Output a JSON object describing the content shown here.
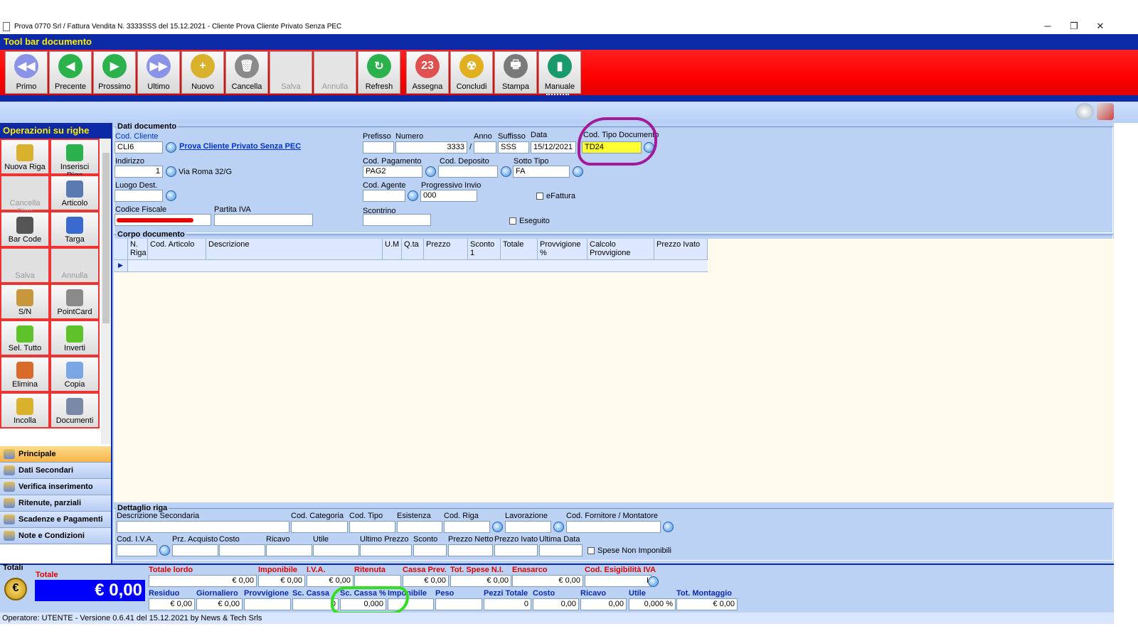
{
  "window": {
    "title": "Prova 0770 Srl / Fattura Vendita N. 3333SSS del 15.12.2021 - Cliente Prova Cliente Privato Senza PEC",
    "minimize": "─",
    "restore": "❐",
    "close": "✕"
  },
  "toolbar": {
    "title": "Tool bar documento",
    "buttons": [
      {
        "label": "Primo",
        "icon": "first-icon",
        "glyph": "◀◀",
        "color": "#8a93e6",
        "enabled": true
      },
      {
        "label": "Precente",
        "icon": "previous-icon",
        "glyph": "◀",
        "color": "#2bb24c",
        "enabled": true
      },
      {
        "label": "Prossimo",
        "icon": "next-icon",
        "glyph": "▶",
        "color": "#2bb24c",
        "enabled": true
      },
      {
        "label": "Ultimo",
        "icon": "last-icon",
        "glyph": "▶▶",
        "color": "#8a93e6",
        "enabled": true
      },
      {
        "label": "Nuovo",
        "icon": "new-icon",
        "glyph": "+",
        "color": "#d9b12c",
        "enabled": true
      },
      {
        "label": "Cancella",
        "icon": "trash-icon",
        "glyph": "🗑",
        "color": "#8a8a8a",
        "enabled": true
      },
      {
        "label": "Salva",
        "icon": "save-icon",
        "glyph": "",
        "color": "#e4e4e4",
        "enabled": false
      },
      {
        "label": "Annulla",
        "icon": "undo-icon",
        "glyph": "",
        "color": "#e4e4e4",
        "enabled": false
      },
      {
        "label": "Refresh",
        "icon": "refresh-icon",
        "glyph": "↻",
        "color": "#2bb24c",
        "enabled": true
      },
      {
        "label": "Assegna",
        "icon": "calendar-numbers-icon",
        "glyph": "23",
        "color": "#e05050",
        "enabled": true
      },
      {
        "label": "Concludi",
        "icon": "radiation-icon",
        "glyph": "☢",
        "color": "#e0b020",
        "enabled": true
      },
      {
        "label": "Stampa",
        "icon": "printer-icon",
        "glyph": "🖶",
        "color": "#7a7a7a",
        "enabled": true
      },
      {
        "label": "Manuale",
        "icon": "book-icon",
        "glyph": "▮",
        "color": "#1a9a6a",
        "enabled": true
      }
    ]
  },
  "side": {
    "title": "Operazioni su righe",
    "buttons": [
      {
        "label": "Nuova Riga",
        "icon": "new-row-icon",
        "color": "#d9b12c",
        "enabled": true
      },
      {
        "label": "Inserisci Riga",
        "icon": "insert-row-icon",
        "color": "#2bb24c",
        "enabled": true
      },
      {
        "label": "Cancella Riga",
        "icon": "delete-row-icon",
        "color": "#e0e0e0",
        "enabled": false
      },
      {
        "label": "Articolo",
        "icon": "article-icon",
        "color": "#5a7ab0",
        "enabled": true
      },
      {
        "label": "Bar Code",
        "icon": "barcode-icon",
        "color": "#555555",
        "enabled": true
      },
      {
        "label": "Targa",
        "icon": "license-plate-icon",
        "color": "#3a6ad0",
        "enabled": true
      },
      {
        "label": "Salva",
        "icon": "save-row-icon",
        "color": "#e0e0e0",
        "enabled": false
      },
      {
        "label": "Annulla",
        "icon": "undo-row-icon",
        "color": "#e0e0e0",
        "enabled": false
      },
      {
        "label": "S/N",
        "icon": "serial-number-icon",
        "color": "#c8963c",
        "enabled": true
      },
      {
        "label": "PointCard",
        "icon": "point-card-icon",
        "color": "#8a8a8a",
        "enabled": true
      },
      {
        "label": "Sel. Tutto",
        "icon": "select-all-arrow-icon",
        "color": "#5ec22a",
        "enabled": true
      },
      {
        "label": "Inverti",
        "icon": "invert-arrow-icon",
        "color": "#5ec22a",
        "enabled": true
      },
      {
        "label": "Elimina",
        "icon": "delete-icon",
        "color": "#d86a2a",
        "enabled": true
      },
      {
        "label": "Copia",
        "icon": "copy-icon",
        "color": "#7aa6e6",
        "enabled": true
      },
      {
        "label": "Incolla",
        "icon": "paste-icon",
        "color": "#d9b12c",
        "enabled": true
      },
      {
        "label": "Documenti",
        "icon": "documents-icon",
        "color": "#7a8aa6",
        "enabled": true
      }
    ],
    "nav": [
      {
        "label": "Principale",
        "icon": "main-tab-icon",
        "active": true
      },
      {
        "label": "Dati Secondari",
        "icon": "secondary-data-icon",
        "active": false
      },
      {
        "label": "Verifica inserimento",
        "icon": "verify-icon",
        "active": false
      },
      {
        "label": "Ritenute, parziali",
        "icon": "withholding-icon",
        "active": false
      },
      {
        "label": "Scadenze e Pagamenti",
        "icon": "deadlines-icon",
        "active": false
      },
      {
        "label": "Note e Condizioni",
        "icon": "notes-icon",
        "active": false
      }
    ]
  },
  "doc": {
    "title": "Dati documento",
    "cod_cliente_label": "Cod. Cliente",
    "cod_cliente": "CLI6",
    "cliente_nome": "Prova Cliente Privato Senza PEC",
    "indirizzo_label": "Indirizzo",
    "indirizzo_num": "1",
    "indirizzo": "Via Roma 32/G",
    "luogo_label": "Luogo Dest.",
    "luogo": "",
    "cf_label": "Codice Fiscale",
    "piva_label": "Partita IVA",
    "piva": "",
    "prefisso_label": "Prefisso",
    "prefisso": "",
    "numero_label": "Numero",
    "numero": "3333",
    "slash": "/",
    "anno_label": "Anno",
    "anno": "",
    "suffisso_label": "Suffisso",
    "suffisso": "SSS",
    "data_label": "Data",
    "data": "15/12/2021",
    "tipo_label": "Cod. Tipo Documento",
    "tipo": "TD24",
    "pagamento_label": "Cod. Pagamento",
    "pagamento": "PAG2",
    "deposito_label": "Cod. Deposito",
    "deposito": "",
    "sottotipo_label": "Sotto Tipo",
    "sottotipo": "FA",
    "agente_label": "Cod. Agente",
    "agente": "",
    "progressivo_label": "Progressivo Invio",
    "progressivo": "000",
    "efattura_label": "eFattura",
    "scontrino_label": "Scontrino",
    "scontrino": "",
    "eseguito_label": "Eseguito"
  },
  "body": {
    "title": "Corpo documento",
    "columns": [
      {
        "l1": "N.",
        "l2": "Riga"
      },
      {
        "l1": "Cod. Articolo",
        "l2": ""
      },
      {
        "l1": "Descrizione",
        "l2": ""
      },
      {
        "l1": "U.M",
        "l2": ""
      },
      {
        "l1": "Q.ta",
        "l2": ""
      },
      {
        "l1": "Prezzo",
        "l2": ""
      },
      {
        "l1": "Sconto",
        "l2": "1"
      },
      {
        "l1": "Totale",
        "l2": ""
      },
      {
        "l1": "Provvigione",
        "l2": "%"
      },
      {
        "l1": "Calcolo",
        "l2": "Provvigione"
      },
      {
        "l1": "Prezzo Ivato",
        "l2": ""
      }
    ]
  },
  "detail": {
    "title": "Dettaglio riga",
    "row1": [
      "Descrizione Secondaria",
      "Cod. Categoria",
      "Cod. Tipo",
      "Esistenza",
      "Cod. Riga",
      "Lavorazione",
      "Cod. Fornitore / Montatore"
    ],
    "row2": [
      "Cod. I.V.A.",
      "Prz. Acquisto",
      "Costo",
      "Ricavo",
      "Utile",
      "Ultimo Prezzo",
      "Sconto",
      "Prezzo Netto",
      "Prezzo Ivato",
      "Ultima Data"
    ],
    "spese_label": "Spese Non Imponibili"
  },
  "totals": {
    "title": "Totali",
    "totale_label": "Totale",
    "totale": "€ 0,00",
    "euro_glyph": "€",
    "r1": [
      {
        "label": "Totale lordo",
        "value": "€ 0,00"
      },
      {
        "label": "Imponibile",
        "value": "€ 0,00"
      },
      {
        "label": "I.V.A.",
        "value": "€ 0,00"
      },
      {
        "label": "Ritenuta",
        "value": ""
      },
      {
        "label": "Cassa Prev.",
        "value": "€ 0,00"
      },
      {
        "label": "Tot. Spese N.I.",
        "value": "€ 0,00"
      },
      {
        "label": "Enasarco",
        "value": "€ 0,00"
      },
      {
        "label": "Cod. Esigibilità IVA",
        "value": "I"
      }
    ],
    "r2": [
      {
        "label": "Residuo",
        "value": "€ 0,00"
      },
      {
        "label": "Giornaliero",
        "value": "€ 0,00"
      },
      {
        "label": "Provvigione",
        "value": ""
      },
      {
        "label": "Sc. Cassa",
        "value": "0"
      },
      {
        "label": "Sc. Cassa %",
        "value": "0,000"
      },
      {
        "label": "Imponibile",
        "value": ""
      },
      {
        "label": "Peso",
        "value": ""
      },
      {
        "label": "Pezzi Totale",
        "value": "0"
      },
      {
        "label": "Costo",
        "value": "0,00"
      },
      {
        "label": "Ricavo",
        "value": "0,00"
      },
      {
        "label": "Utile",
        "value": "0,000 %"
      },
      {
        "label": "Tot. Montaggio",
        "value": "€ 0,00"
      }
    ]
  },
  "status": "Operatore: UTENTE - Versione 0.6.41 del 15.12.2021 by News & Tech Srls"
}
